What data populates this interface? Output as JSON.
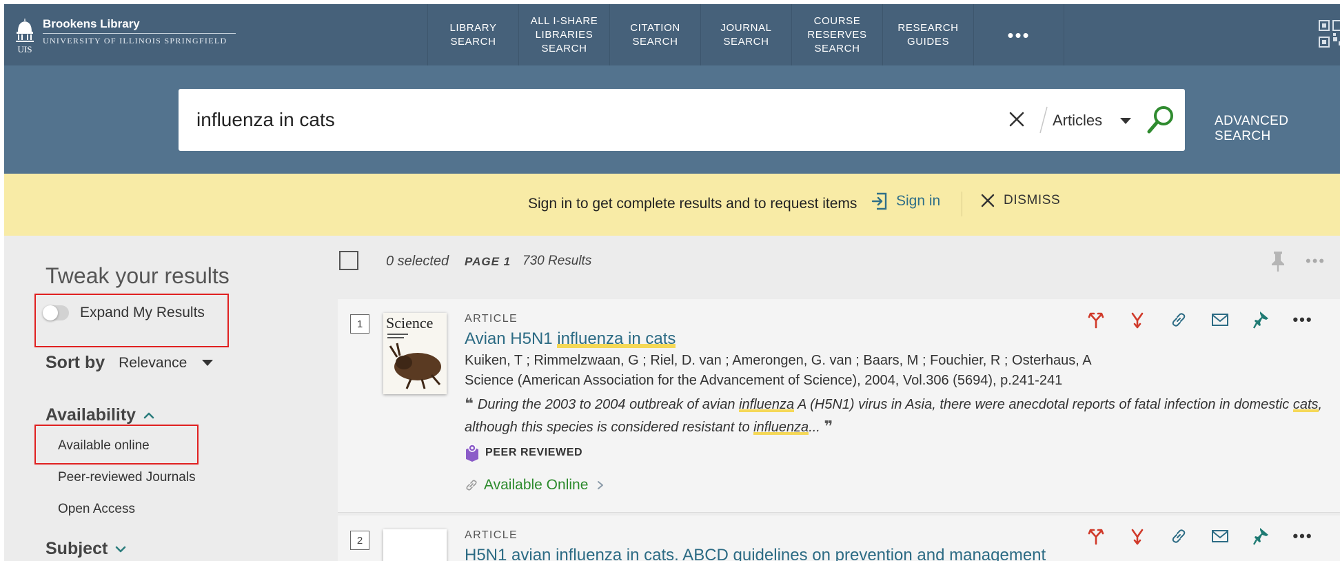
{
  "header": {
    "logo_name": "Brookens Library",
    "logo_sub": "UNIVERSITY OF ILLINOIS SPRINGFIELD",
    "logo_mark": "UIS",
    "nav": [
      {
        "label": "LIBRARY SEARCH"
      },
      {
        "label": "ALL I-SHARE LIBRARIES SEARCH"
      },
      {
        "label": "CITATION SEARCH"
      },
      {
        "label": "JOURNAL SEARCH"
      },
      {
        "label": "COURSE RESERVES SEARCH"
      },
      {
        "label": "RESEARCH GUIDES"
      }
    ],
    "more_label": "•••"
  },
  "search": {
    "query": "influenza in cats",
    "scope": "Articles",
    "advanced_label": "ADVANCED SEARCH"
  },
  "banner": {
    "message": "Sign in to get complete results and to request items",
    "signin_label": "Sign in",
    "dismiss_label": "DISMISS"
  },
  "sidebar": {
    "title": "Tweak your results",
    "expand_label": "Expand My Results",
    "sort_label": "Sort by",
    "sort_value": "Relevance",
    "availability_label": "Availability",
    "availability_items": [
      "Available online",
      "Peer-reviewed Journals",
      "Open Access"
    ],
    "subject_label": "Subject"
  },
  "results_toolbar": {
    "selected": "0 selected",
    "page": "PAGE 1",
    "count": "730 Results"
  },
  "results": [
    {
      "number": "1",
      "type": "ARTICLE",
      "title_pre": "Avian H5N1 ",
      "title_hl": "influenza in cats",
      "authors": "Kuiken, T ; Rimmelzwaan, G ; Riel, D. van ; Amerongen, G. van ; Baars, M ; Fouchier, R ; Osterhaus, A",
      "source": "Science (American Association for the Advancement of Science), 2004, Vol.306 (5694), p.241-241",
      "abstract_1": "During the 2003 to 2004 outbreak of avian ",
      "abstract_hl1": "influenza",
      "abstract_2": " A (H5N1) virus in Asia, there were anecdotal reports of fatal infection in domestic ",
      "abstract_hl2": "cats",
      "abstract_3": ", although this species is considered resistant to ",
      "abstract_hl3": "influenza",
      "abstract_4": "...",
      "peer_label": "PEER REVIEWED",
      "availability": "Available Online",
      "thumb_title": "Science"
    },
    {
      "number": "2",
      "type": "ARTICLE",
      "title": "H5N1 avian influenza in cats. ABCD guidelines on prevention and management"
    }
  ],
  "colors": {
    "header_bg": "#46617a",
    "search_band_bg": "#53738e",
    "banner_bg": "#f8eba6",
    "link": "#2c6b84",
    "available": "#2b8a2b",
    "highlight": "#f5d857",
    "annotation_red": "#e02020"
  }
}
